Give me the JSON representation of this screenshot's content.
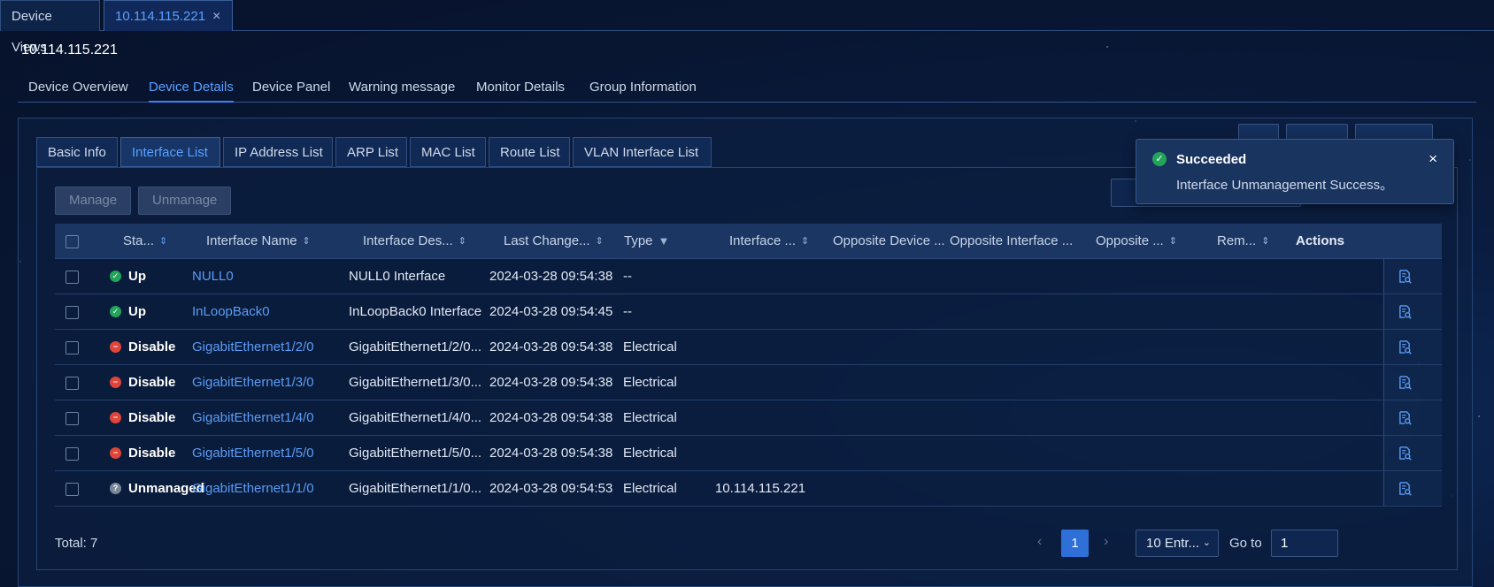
{
  "window_tabs": [
    {
      "label": "Device Views"
    },
    {
      "label": "10.114.115.221",
      "close": "×"
    }
  ],
  "page_title": "10.114.115.221",
  "device_tabs": [
    "Device Overview",
    "Device Details",
    "Device Panel",
    "Warning message",
    "Monitor Details",
    "Group Information"
  ],
  "active_device_tab": "Device Details",
  "sub_tabs": [
    "Basic Info",
    "Interface List",
    "IP Address List",
    "ARP List",
    "MAC List",
    "Route List",
    "VLAN Interface List"
  ],
  "active_sub_tab": "Interface List",
  "buttons": {
    "manage": "Manage",
    "unmanage": "Unmanage"
  },
  "table": {
    "headers": [
      "Sta...",
      "Interface Name",
      "Interface Des...",
      "Last Change...",
      "Type",
      "Interface ...",
      "Opposite Device ...",
      "Opposite Interface ...",
      "Opposite ...",
      "Rem...",
      "Actions"
    ],
    "rows": [
      {
        "status": "Up",
        "status_kind": "up",
        "name": "NULL0",
        "desc": "NULL0 Interface",
        "last_change": "2024-03-28 09:54:38",
        "type": "--",
        "iface": ""
      },
      {
        "status": "Up",
        "status_kind": "up",
        "name": "InLoopBack0",
        "desc": "InLoopBack0 Interface",
        "last_change": "2024-03-28 09:54:45",
        "type": "--",
        "iface": ""
      },
      {
        "status": "Disable",
        "status_kind": "dis",
        "name": "GigabitEthernet1/2/0",
        "desc": "GigabitEthernet1/2/0...",
        "last_change": "2024-03-28 09:54:38",
        "type": "Electrical",
        "iface": ""
      },
      {
        "status": "Disable",
        "status_kind": "dis",
        "name": "GigabitEthernet1/3/0",
        "desc": "GigabitEthernet1/3/0...",
        "last_change": "2024-03-28 09:54:38",
        "type": "Electrical",
        "iface": ""
      },
      {
        "status": "Disable",
        "status_kind": "dis",
        "name": "GigabitEthernet1/4/0",
        "desc": "GigabitEthernet1/4/0...",
        "last_change": "2024-03-28 09:54:38",
        "type": "Electrical",
        "iface": ""
      },
      {
        "status": "Disable",
        "status_kind": "dis",
        "name": "GigabitEthernet1/5/0",
        "desc": "GigabitEthernet1/5/0...",
        "last_change": "2024-03-28 09:54:38",
        "type": "Electrical",
        "iface": ""
      },
      {
        "status": "Unmanaged",
        "status_kind": "unm",
        "name": "GigabitEthernet1/1/0",
        "desc": "GigabitEthernet1/1/0...",
        "last_change": "2024-03-28 09:54:53",
        "type": "Electrical",
        "iface": "10.114.115.221"
      }
    ]
  },
  "pagination": {
    "total": "Total: 7",
    "current_page": "1",
    "page_size": "10 Entr...",
    "goto_label": "Go to",
    "goto_value": "1"
  },
  "toast": {
    "title": "Succeeded",
    "message": "Interface Unmanagement Success。",
    "close": "×"
  },
  "colors": {
    "accent": "#5aa0ff",
    "success": "#22a55a",
    "danger": "#e0453a",
    "primary_button": "#2f6fd8"
  }
}
